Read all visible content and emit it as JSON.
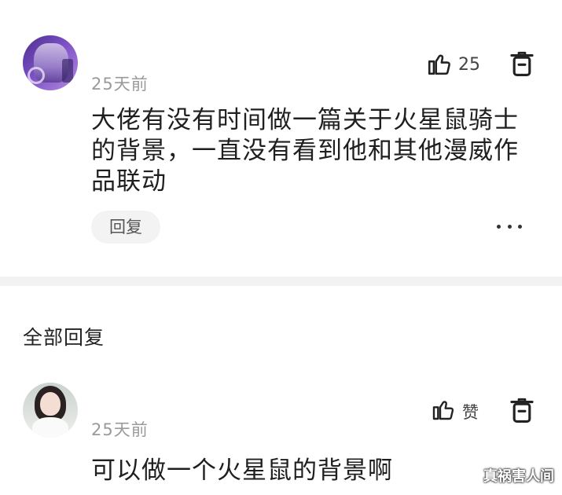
{
  "comment": {
    "time": "25天前",
    "like_count": "25",
    "text": "大佬有没有时间做一篇关于火星鼠骑士的背景，一直没有看到他和其他漫威作品联动",
    "reply_label": "回复",
    "icons": {
      "like": "thumbs-up-icon",
      "delete": "trash-icon",
      "more": "more-icon"
    }
  },
  "replies_section": {
    "title": "全部回复"
  },
  "reply": {
    "time": "25天前",
    "like_label": "赞",
    "text": "可以做一个火星鼠的背景啊",
    "icons": {
      "like": "thumbs-up-icon",
      "delete": "trash-icon"
    }
  },
  "watermark": "真祸害人间",
  "colors": {
    "text": "#1f1f1f",
    "muted": "#9a9a9a",
    "divider": "#f2f2f2",
    "reply_button_bg": "#f3f3f3"
  }
}
